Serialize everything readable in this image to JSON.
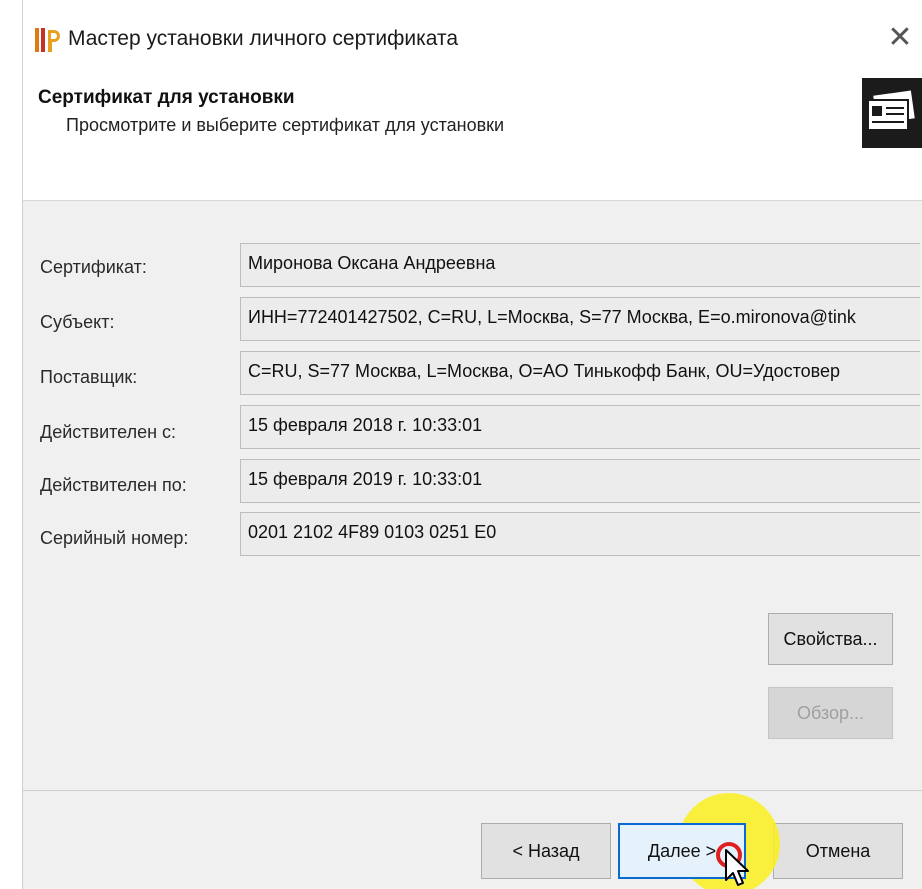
{
  "window": {
    "title": "Мастер установки личного сертификата",
    "close_glyph": "✕"
  },
  "header": {
    "title": "Сертификат для установки",
    "subtitle": "Просмотрите и выберите сертификат для установки"
  },
  "fields": [
    {
      "label": "Сертификат:",
      "value": "Миронова Оксана Андреевна"
    },
    {
      "label": "Субъект:",
      "value": "ИНН=772401427502, C=RU, L=Москва, S=77 Москва, E=o.mironova@tink"
    },
    {
      "label": "Поставщик:",
      "value": "C=RU, S=77 Москва, L=Москва, O=АО Тинькофф Банк, OU=Удостовер"
    },
    {
      "label": "Действителен с:",
      "value": "15 февраля 2018 г. 10:33:01"
    },
    {
      "label": "Действителен по:",
      "value": "15 февраля 2019 г. 10:33:01"
    },
    {
      "label": "Серийный номер:",
      "value": "0201 2102 4F89 0103 0251 E0"
    }
  ],
  "buttons": {
    "properties": "Свойства...",
    "browse": "Обзор...",
    "back": "< Назад",
    "next": "Далее >",
    "cancel": "Отмена"
  },
  "colors": {
    "accent_focus": "#0a6ad4",
    "cursor_highlight": "#faf01e",
    "cursor_ring": "#e02020"
  },
  "icons": [
    "app-logo-icon",
    "close-icon",
    "certificate-icon",
    "mouse-cursor-icon"
  ]
}
